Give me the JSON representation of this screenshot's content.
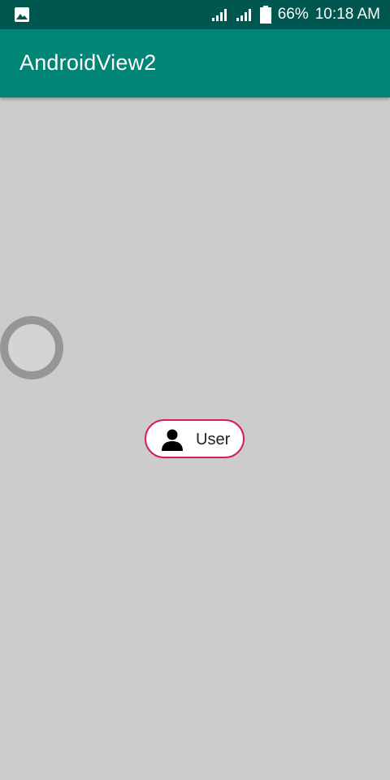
{
  "status_bar": {
    "notification_icon": "image-icon",
    "signal_icon": "signal-icon",
    "battery_icon": "battery-icon",
    "battery_percent": "66%",
    "time": "10:18 AM"
  },
  "app_bar": {
    "title": "AndroidView2"
  },
  "content": {
    "loading_indicator": "progress-ring",
    "chip": {
      "icon": "user-icon",
      "label": "User",
      "border_color": "#d81b60"
    }
  },
  "colors": {
    "status_bar": "#00574f",
    "app_bar": "#008577",
    "background": "#cccccc"
  }
}
